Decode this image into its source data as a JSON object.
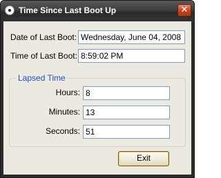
{
  "window": {
    "title": "Time Since Last Boot Up",
    "close_glyph": "✕"
  },
  "boot": {
    "date_label": "Date of Last Boot:",
    "date_value": "Wednesday, June 04, 2008",
    "time_label": "Time of Last Boot:",
    "time_value": "8:59:02 PM"
  },
  "lapsed": {
    "group_title": "Lapsed Time",
    "hours_label": "Hours:",
    "hours_value": "8",
    "minutes_label": "Minutes:",
    "minutes_value": "13",
    "seconds_label": "Seconds:",
    "seconds_value": "51"
  },
  "buttons": {
    "exit_label": "Exit"
  },
  "colors": {
    "group_title": "#1f4ec4",
    "close_button": "#c2421f"
  },
  "icons": {
    "app": "app-icon",
    "close": "close-icon"
  }
}
